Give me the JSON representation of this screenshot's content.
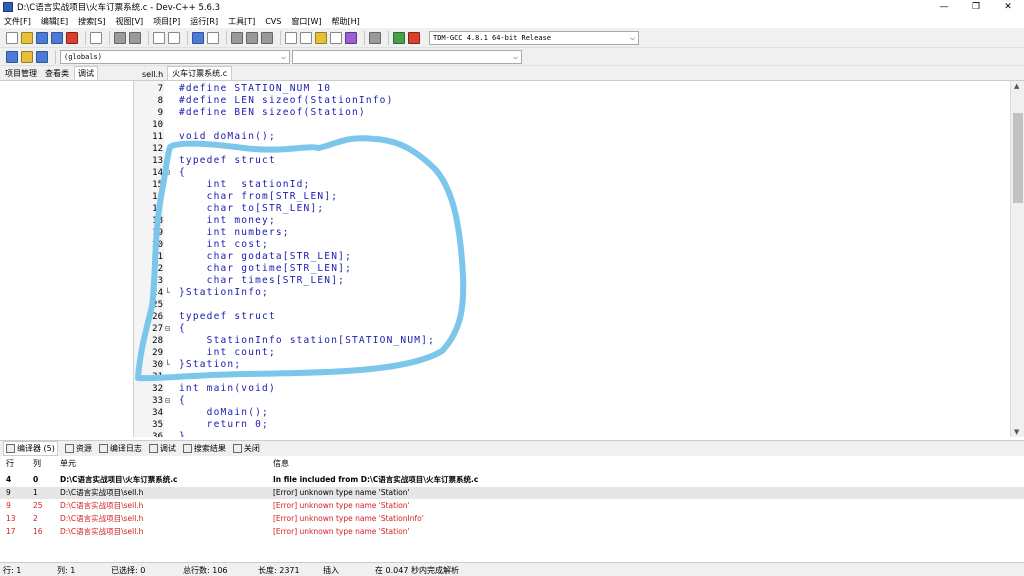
{
  "window": {
    "title": "D:\\C语言实战项目\\火车订票系统.c - Dev-C++ 5.6.3",
    "controls": {
      "minimize": "—",
      "maximize": "❐",
      "close": "✕"
    }
  },
  "menu": [
    "文件[F]",
    "编辑[E]",
    "搜索[S]",
    "视图[V]",
    "项目[P]",
    "运行[R]",
    "工具[T]",
    "CVS",
    "窗口[W]",
    "帮助[H]"
  ],
  "toolbar": {
    "compiler_select": "TDM-GCC 4.8.1 64-bit Release",
    "scope_select": "(globals)",
    "function_select": ""
  },
  "left_tabs": [
    "项目管理",
    "查看类",
    "调试"
  ],
  "file_tabs": [
    "sell.h",
    "火车订票系统.c"
  ],
  "code": [
    {
      "n": "7",
      "fold": "",
      "text": "#define STATION_NUM 10"
    },
    {
      "n": "8",
      "fold": "",
      "text": "#define LEN sizeof(StationInfo)"
    },
    {
      "n": "9",
      "fold": "",
      "text": "#define BEN sizeof(Station)"
    },
    {
      "n": "10",
      "fold": "",
      "text": ""
    },
    {
      "n": "11",
      "fold": "",
      "text": "void doMain();"
    },
    {
      "n": "12",
      "fold": "",
      "text": ""
    },
    {
      "n": "13",
      "fold": "",
      "text": "typedef struct"
    },
    {
      "n": "14",
      "fold": "⊟",
      "text": "{"
    },
    {
      "n": "15",
      "fold": "",
      "text": "    int  stationId;"
    },
    {
      "n": "16",
      "fold": "",
      "text": "    char from[STR_LEN];"
    },
    {
      "n": "17",
      "fold": "",
      "text": "    char to[STR_LEN];"
    },
    {
      "n": "18",
      "fold": "",
      "text": "    int money;"
    },
    {
      "n": "19",
      "fold": "",
      "text": "    int numbers;"
    },
    {
      "n": "20",
      "fold": "",
      "text": "    int cost;"
    },
    {
      "n": "21",
      "fold": "",
      "text": "    char godata[STR_LEN];"
    },
    {
      "n": "22",
      "fold": "",
      "text": "    char gotime[STR_LEN];"
    },
    {
      "n": "23",
      "fold": "",
      "text": "    char times[STR_LEN];"
    },
    {
      "n": "24",
      "fold": "└",
      "text": "}StationInfo;"
    },
    {
      "n": "25",
      "fold": "",
      "text": ""
    },
    {
      "n": "26",
      "fold": "",
      "text": "typedef struct"
    },
    {
      "n": "27",
      "fold": "⊟",
      "text": "{"
    },
    {
      "n": "28",
      "fold": "",
      "text": "    StationInfo station[STATION_NUM];"
    },
    {
      "n": "29",
      "fold": "",
      "text": "    int count;"
    },
    {
      "n": "30",
      "fold": "└",
      "text": "}Station;"
    },
    {
      "n": "31",
      "fold": "",
      "text": ""
    },
    {
      "n": "32",
      "fold": "",
      "text": "int main(void)"
    },
    {
      "n": "33",
      "fold": "⊟",
      "text": "{"
    },
    {
      "n": "34",
      "fold": "",
      "text": "    doMain();"
    },
    {
      "n": "35",
      "fold": "",
      "text": "    return 0;"
    },
    {
      "n": "36",
      "fold": "",
      "text": "}"
    }
  ],
  "bottom_tabs": [
    {
      "label": "编译器 (5)",
      "icon": "grid-icon"
    },
    {
      "label": "资源",
      "icon": "resource-icon"
    },
    {
      "label": "编译日志",
      "icon": "chart-icon"
    },
    {
      "label": "调试",
      "icon": "check-icon"
    },
    {
      "label": "搜索结果",
      "icon": "search-icon"
    },
    {
      "label": "关闭",
      "icon": "close-icon"
    }
  ],
  "messages": {
    "headers": [
      "行",
      "列",
      "单元",
      "信息"
    ],
    "rows": [
      {
        "line": "4",
        "col": "0",
        "unit": "D:\\C语言实战项目\\火车订票系统.c",
        "msg": "In file included from D:\\C语言实战项目\\火车订票系统.c",
        "style": "bold"
      },
      {
        "line": "9",
        "col": "1",
        "unit": "D:\\C语言实战项目\\sell.h",
        "msg": "[Error] unknown type name 'Station'",
        "style": "selected"
      },
      {
        "line": "9",
        "col": "25",
        "unit": "D:\\C语言实战项目\\sell.h",
        "msg": "[Error] unknown type name 'Station'",
        "style": "err"
      },
      {
        "line": "13",
        "col": "2",
        "unit": "D:\\C语言实战项目\\sell.h",
        "msg": "[Error] unknown type name 'StationInfo'",
        "style": "err"
      },
      {
        "line": "17",
        "col": "16",
        "unit": "D:\\C语言实战项目\\sell.h",
        "msg": "[Error] unknown type name 'Station'",
        "style": "err"
      }
    ]
  },
  "status": {
    "row": "行:   1",
    "col": "列:   1",
    "selected": "已选择:   0",
    "total": "总行数:  106",
    "length": "长度:  2371",
    "mode": "插入",
    "parse": "在 0.047 秒内完成解析"
  },
  "colors": {
    "keyword": "#1a1ab0",
    "error": "#d42020",
    "annotation": "#7cc6ec"
  }
}
